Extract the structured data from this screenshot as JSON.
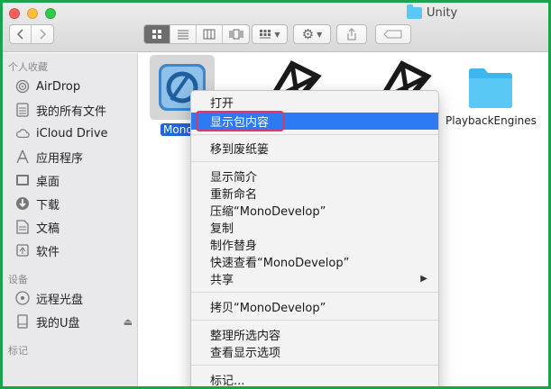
{
  "window": {
    "title": "Unity"
  },
  "colors": {
    "selection": "#2166d8",
    "menu_highlight": "#2d7bf4",
    "annotation_box": "#e0356d",
    "frame_border": "#1aa34a"
  },
  "toolbar": {
    "back_icon": "chevron-left-icon",
    "forward_icon": "chevron-right-icon",
    "view_modes": [
      "icon-view",
      "list-view",
      "column-view",
      "cover-flow-view"
    ],
    "arrange_icon": "arrange-grid-icon",
    "action_icon": "gear-icon",
    "share_icon": "share-icon",
    "tag_icon": "tag-icon"
  },
  "sidebar": {
    "favorites_header": "个人收藏",
    "favorites": [
      {
        "label": "AirDrop",
        "icon": "airdrop-icon"
      },
      {
        "label": "我的所有文件",
        "icon": "all-files-icon"
      },
      {
        "label": "iCloud Drive",
        "icon": "cloud-icon"
      },
      {
        "label": "应用程序",
        "icon": "applications-icon"
      },
      {
        "label": "桌面",
        "icon": "desktop-icon"
      },
      {
        "label": "下载",
        "icon": "download-icon"
      },
      {
        "label": "文稿",
        "icon": "documents-icon"
      },
      {
        "label": "软件",
        "icon": "folder-icon"
      }
    ],
    "devices_header": "设备",
    "devices": [
      {
        "label": "远程光盘",
        "icon": "remote-disc-icon"
      },
      {
        "label": "我的U盘",
        "icon": "usb-drive-icon"
      }
    ],
    "tags_header": "标记"
  },
  "files": [
    {
      "label": "MonoD",
      "icon": "monodevelop-app-icon",
      "selected": true
    },
    {
      "label": "",
      "icon": "unity-app-icon",
      "selected": false
    },
    {
      "label": "",
      "icon": "unity-app-icon",
      "selected": false
    },
    {
      "label": "PlaybackEngines",
      "icon": "folder-icon",
      "selected": false
    }
  ],
  "context_menu": {
    "groups": [
      [
        "打开",
        "显示包内容"
      ],
      [
        "移到废纸篓"
      ],
      [
        "显示简介",
        "重新命名",
        "压缩“MonoDevelop”",
        "复制",
        "制作替身",
        "快速查看“MonoDevelop”",
        "共享"
      ],
      [
        "拷贝“MonoDevelop”"
      ],
      [
        "整理所选内容",
        "查看显示选项"
      ],
      [
        "标记..."
      ]
    ],
    "highlighted_item": "显示包内容",
    "submenu_item": "共享"
  }
}
